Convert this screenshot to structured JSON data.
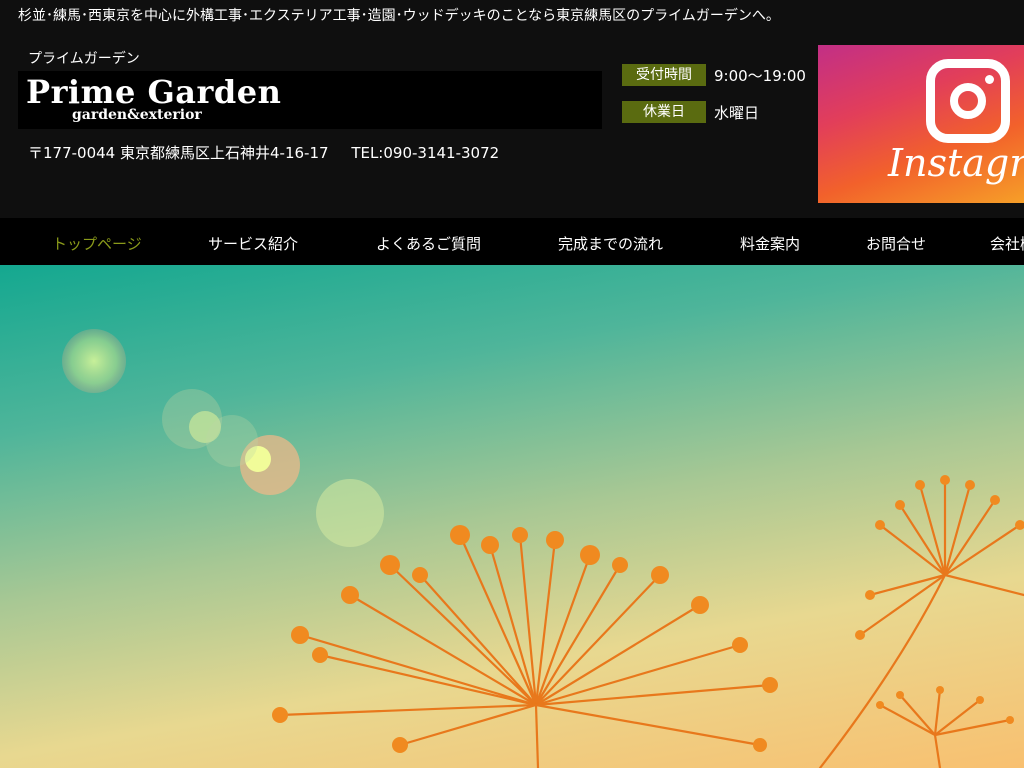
{
  "tagline": "杉並･練馬･西東京を中心に外構工事･エクステリア工事･造園･ウッドデッキのことなら東京練馬区のプライムガーデンへ。",
  "header": {
    "kana_name": "プライムガーデン",
    "logo_main": "Prime Garden",
    "logo_sub": "garden&exterior",
    "address": "〒177-0044 東京都練馬区上石神井4-16-17",
    "tel": "TEL:090-3141-3072",
    "hours_label": "受付時間",
    "hours_value": "9:00〜19:00",
    "closed_label": "休業日",
    "closed_value": "水曜日"
  },
  "instagram": {
    "text": "Instagram",
    "icon": "instagram-icon",
    "colors": [
      "#c22f86",
      "#e23e5a",
      "#f2612b",
      "#f6a028"
    ]
  },
  "nav": {
    "items": [
      {
        "label": "トップページ",
        "active": true
      },
      {
        "label": "サービス紹介"
      },
      {
        "label": "よくあるご質問"
      },
      {
        "label": "完成までの流れ"
      },
      {
        "label": "料金案内"
      },
      {
        "label": "お問合せ"
      },
      {
        "label": "会社概要"
      }
    ],
    "active_color": "#8a9a1a"
  },
  "colors": {
    "background": "#0f0f0f",
    "label_bg": "#5a6b10"
  }
}
